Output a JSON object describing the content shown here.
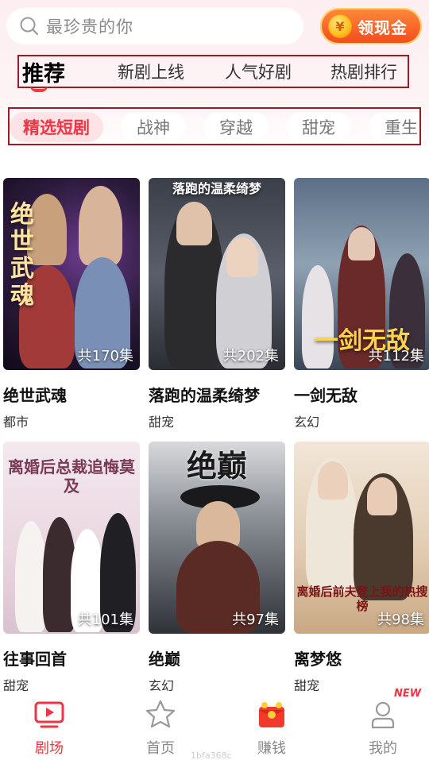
{
  "search": {
    "placeholder": "最珍贵的你"
  },
  "cash_button": {
    "label": "领现金",
    "coin_symbol": "¥"
  },
  "main_tabs": [
    {
      "label": "推荐",
      "active": true
    },
    {
      "label": "新剧上线"
    },
    {
      "label": "人气好剧"
    },
    {
      "label": "热剧排行"
    }
  ],
  "sub_tabs": [
    {
      "label": "精选短剧",
      "active": true
    },
    {
      "label": "战神"
    },
    {
      "label": "穿越"
    },
    {
      "label": "甜宠"
    },
    {
      "label": "重生"
    }
  ],
  "dramas": [
    {
      "title": "绝世武魂",
      "genre": "都市",
      "episodes": "共170集",
      "poster_text": "绝世武魂"
    },
    {
      "title": "落跑的温柔绮梦",
      "genre": "甜宠",
      "episodes": "共202集",
      "poster_text": "落跑的温柔绮梦"
    },
    {
      "title": "一剑无敌",
      "genre": "玄幻",
      "episodes": "共112集",
      "poster_text": "一剑无敌"
    },
    {
      "title": "往事回首",
      "genre": "甜宠",
      "episodes": "共101集",
      "poster_text": "离婚后总裁追悔莫及"
    },
    {
      "title": "绝巅",
      "genre": "玄幻",
      "episodes": "共97集",
      "poster_text": "绝巅"
    },
    {
      "title": "离梦悠",
      "genre": "甜宠",
      "episodes": "共98集",
      "poster_text": "离婚后前夫登上我的热搜榜"
    }
  ],
  "bottom_nav": [
    {
      "label": "剧场",
      "icon": "play-screen-icon",
      "active": true
    },
    {
      "label": "首页",
      "icon": "star-icon"
    },
    {
      "label": "赚钱",
      "icon": "red-envelope-icon"
    },
    {
      "label": "我的",
      "icon": "user-icon",
      "badge": "NEW"
    }
  ],
  "watermark": "1bfa368c",
  "colors": {
    "accent": "#ef3443",
    "tab_outline": "#9b1b26",
    "cash_button": "#f24a1e"
  }
}
